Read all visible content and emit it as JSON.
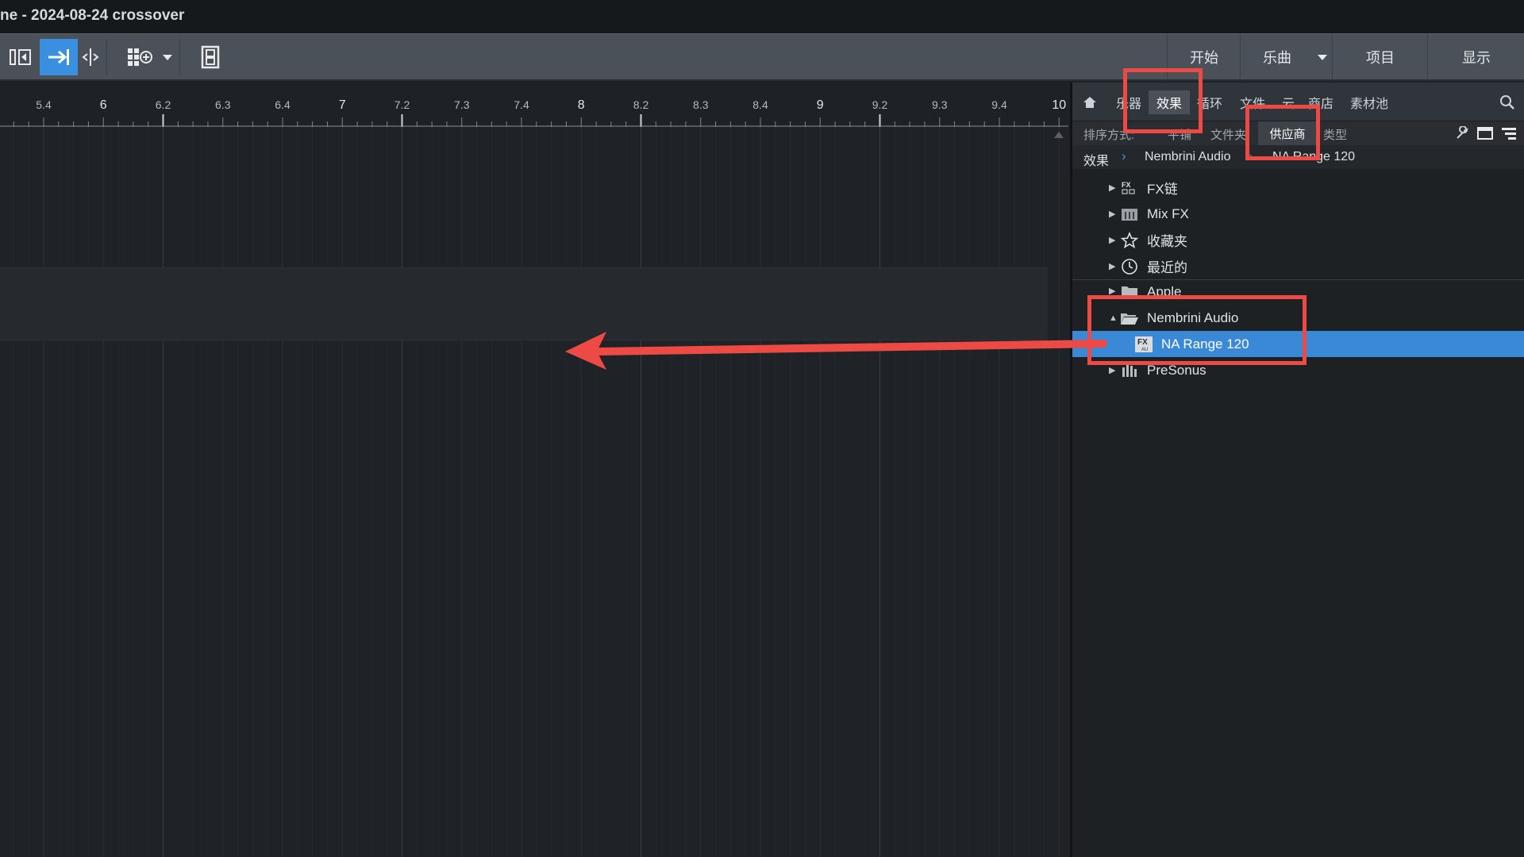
{
  "window": {
    "title": "ne - 2024-08-24 crossover"
  },
  "toolbar": {
    "nav": [
      "开始",
      "乐曲",
      "项目",
      "显示"
    ],
    "icons": [
      "panel-toggle-icon",
      "snap-arrow-icon",
      "split-icon",
      "grid-add-icon",
      "dropdown-caret-icon",
      "film-icon"
    ]
  },
  "ruler": {
    "ticks": [
      "5.4",
      "6",
      "6.2",
      "6.3",
      "6.4",
      "7",
      "7.2",
      "7.3",
      "7.4",
      "8",
      "8.2",
      "8.3",
      "8.4",
      "9",
      "9.2",
      "9.3",
      "9.4",
      "10"
    ],
    "major": [
      "6",
      "7",
      "8",
      "9",
      "10"
    ]
  },
  "browser": {
    "tabs": [
      "乐器",
      "效果",
      "循环",
      "文件",
      "云",
      "商店",
      "素材池"
    ],
    "active_tab": "效果",
    "sort_label": "排序方式:",
    "sort_options": [
      "平铺",
      "文件夹",
      "供应商",
      "类型"
    ],
    "active_sort": "供应商",
    "breadcrumb": [
      "效果",
      "Nembrini Audio",
      "NA Range 120"
    ],
    "tree": [
      {
        "label": "FX链",
        "icon": "fx-chain-icon",
        "expanded": false
      },
      {
        "label": "Mix FX",
        "icon": "mix-fx-icon",
        "expanded": false
      },
      {
        "label": "收藏夹",
        "icon": "star-icon",
        "expanded": false
      },
      {
        "label": "最近的",
        "icon": "clock-icon",
        "expanded": false
      },
      {
        "label": "Apple",
        "icon": "folder-icon",
        "expanded": false
      },
      {
        "label": "Nembrini Audio",
        "icon": "folder-open-icon",
        "expanded": true
      },
      {
        "label": "NA Range 120",
        "icon": "fx-au-icon",
        "selected": true
      },
      {
        "label": "PreSonus",
        "icon": "presonus-icon",
        "expanded": false
      }
    ]
  },
  "colors": {
    "highlight": "#ee4a45",
    "selection": "#3a89d6",
    "active_tool": "#3b8fe0"
  }
}
